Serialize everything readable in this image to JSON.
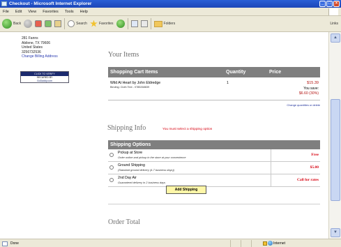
{
  "window": {
    "title": "Checkout - Microsoft Internet Explorer"
  },
  "menu": [
    "File",
    "Edit",
    "View",
    "Favorites",
    "Tools",
    "Help"
  ],
  "toolbar": {
    "back": "Back",
    "search": "Search",
    "favorites": "Favorites",
    "folders": "Folders",
    "links": "Links"
  },
  "address": {
    "lines": [
      "281 Fanns",
      "Abilene, TX 79606",
      "United States",
      "3256732536"
    ],
    "change_link": "Change Billing Address"
  },
  "seal": {
    "top": "CLICK TO VERIFY",
    "mid": "SECURED BY",
    "bot": "GoDaddy.com"
  },
  "items_section": {
    "title": "Your Items",
    "headers": {
      "item": "Shopping Cart Items",
      "qty": "Quantity",
      "price": "Price"
    },
    "rows": [
      {
        "item": "Wild At Heart by John Eldredge",
        "sub": "Binding: Cloth Text - 0785268839",
        "qty": "1",
        "price": "$15.39",
        "save_label": "You save:",
        "save": "$6.60 (30%)"
      }
    ],
    "change_link": "Change quantities or delete"
  },
  "shipping_section": {
    "title": "Shipping Info",
    "warning": "You must select a shipping option",
    "header": "Shipping Options",
    "options": [
      {
        "name": "Pickup at Store",
        "desc": "Order online and pickup in the store at your convenience",
        "cost": "Free"
      },
      {
        "name": "Ground Shipping",
        "desc": "(Standard ground delivery (4-7 business days))",
        "cost": "$5.00"
      },
      {
        "name": "2nd Day Air",
        "desc": "Guaranteed delivery in 2 business days",
        "cost": "Call for rates"
      }
    ],
    "add_button": "Add Shipping"
  },
  "order_section": {
    "title": "Order Total"
  },
  "status": {
    "text": "Done",
    "zone": "Internet"
  },
  "colors": {
    "header_gray": "#7f7f7f",
    "price_red": "#b31513",
    "alert_red": "#d7000f",
    "button_yellow": "#fff7a8"
  }
}
